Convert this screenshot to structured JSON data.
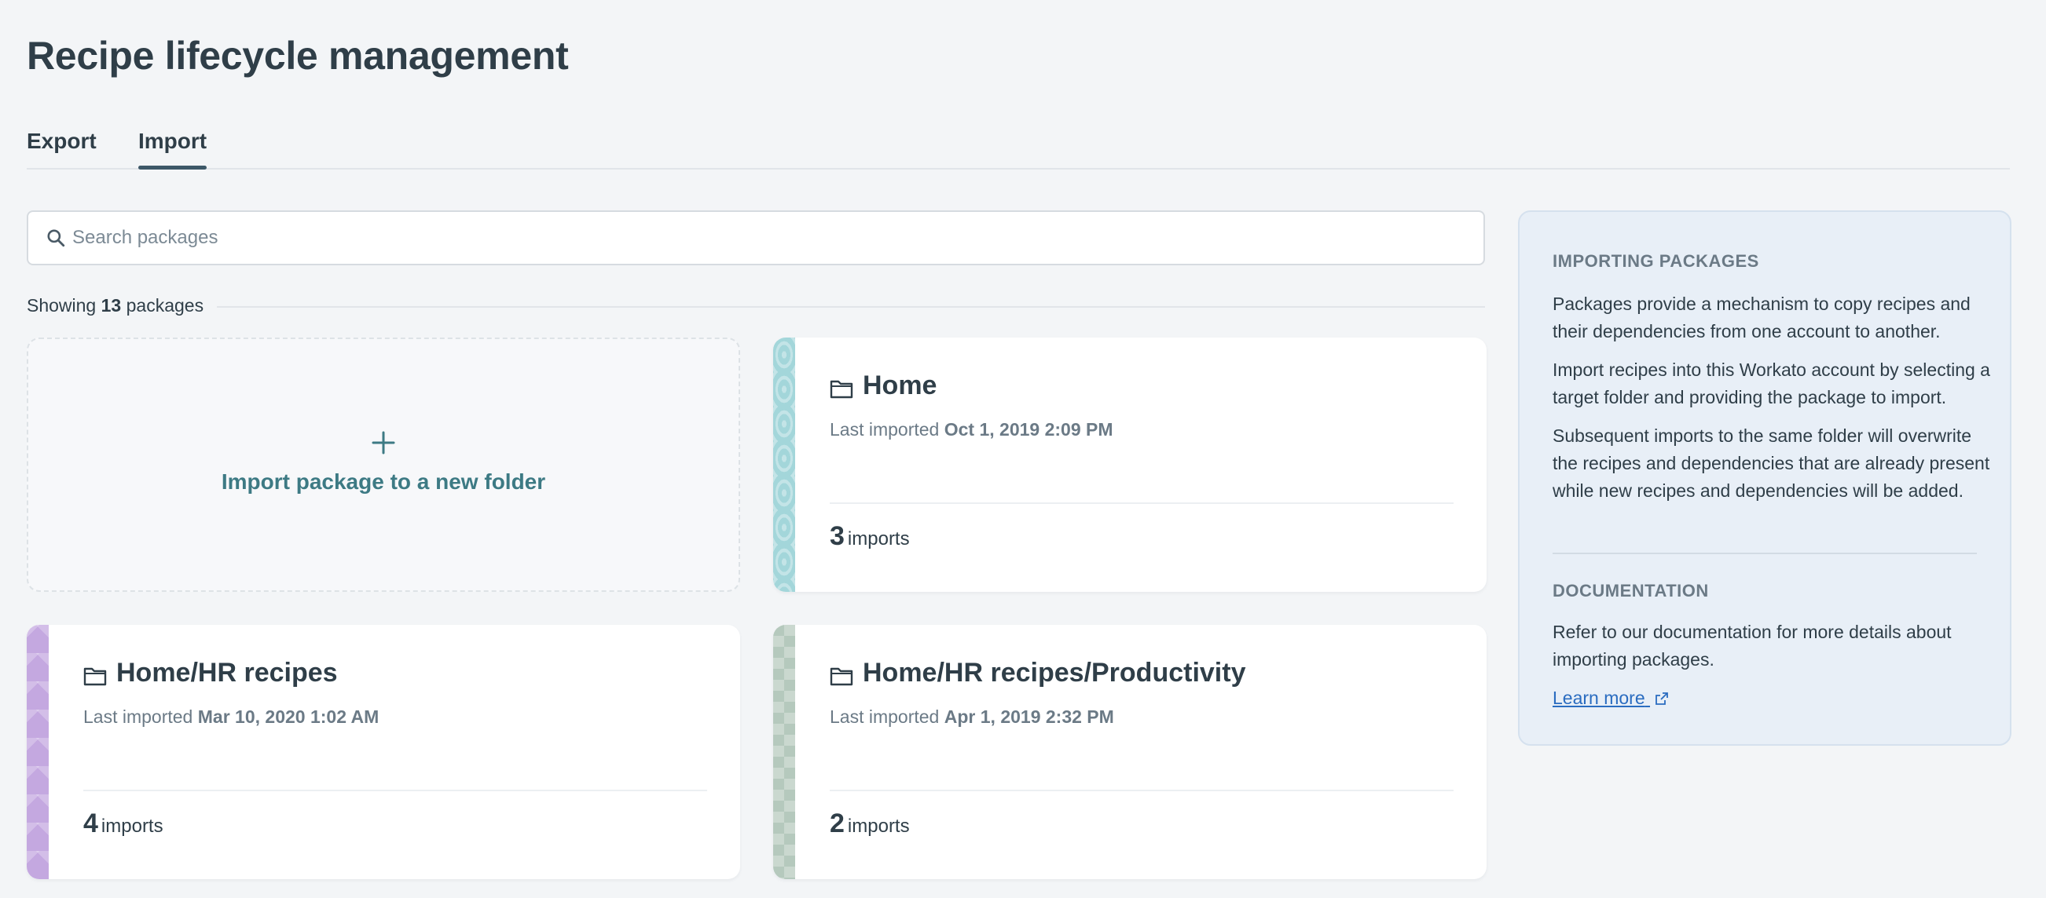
{
  "page": {
    "title": "Recipe lifecycle management"
  },
  "tabs": [
    {
      "label": "Export",
      "active": false
    },
    {
      "label": "Import",
      "active": true
    }
  ],
  "search": {
    "placeholder": "Search packages",
    "value": ""
  },
  "showing": {
    "prefix": "Showing",
    "count": "13",
    "suffix": "packages"
  },
  "new_folder_card": {
    "label": "Import package to a new folder",
    "icon": "plus-icon"
  },
  "packages": [
    {
      "folder": "Home",
      "meta_prefix": "Last imported",
      "last_imported": "Oct 1, 2019 2:09 PM",
      "imports": "3",
      "imports_label": "imports",
      "accent": "#a3d6da"
    },
    {
      "folder": "Home/HR recipes",
      "meta_prefix": "Last imported",
      "last_imported": "Mar 10, 2020 1:02 AM",
      "imports": "4",
      "imports_label": "imports",
      "accent": "#c4a8e0"
    },
    {
      "folder": "Home/HR recipes/Productivity",
      "meta_prefix": "Last imported",
      "last_imported": "Apr 1, 2019 2:32 PM",
      "imports": "2",
      "imports_label": "imports",
      "accent": "#b5c9bd"
    }
  ],
  "sidebar": {
    "importing_heading": "IMPORTING PACKAGES",
    "paragraphs": [
      "Packages provide a mechanism to copy recipes and their dependencies from one account to another.",
      "Import recipes into this Workato account by selecting a target folder and providing the package to import.",
      "Subsequent imports to the same folder will overwrite the recipes and dependencies that are already present while new recipes and dependencies will be added."
    ],
    "documentation_heading": "DOCUMENTATION",
    "documentation_text": "Refer to our documentation for more details about importing packages.",
    "learn_more": "Learn more"
  },
  "colors": {
    "accent_teal": "#3d7a84",
    "link": "#2a6cc0",
    "sidebar_bg": "#e8eff7"
  }
}
